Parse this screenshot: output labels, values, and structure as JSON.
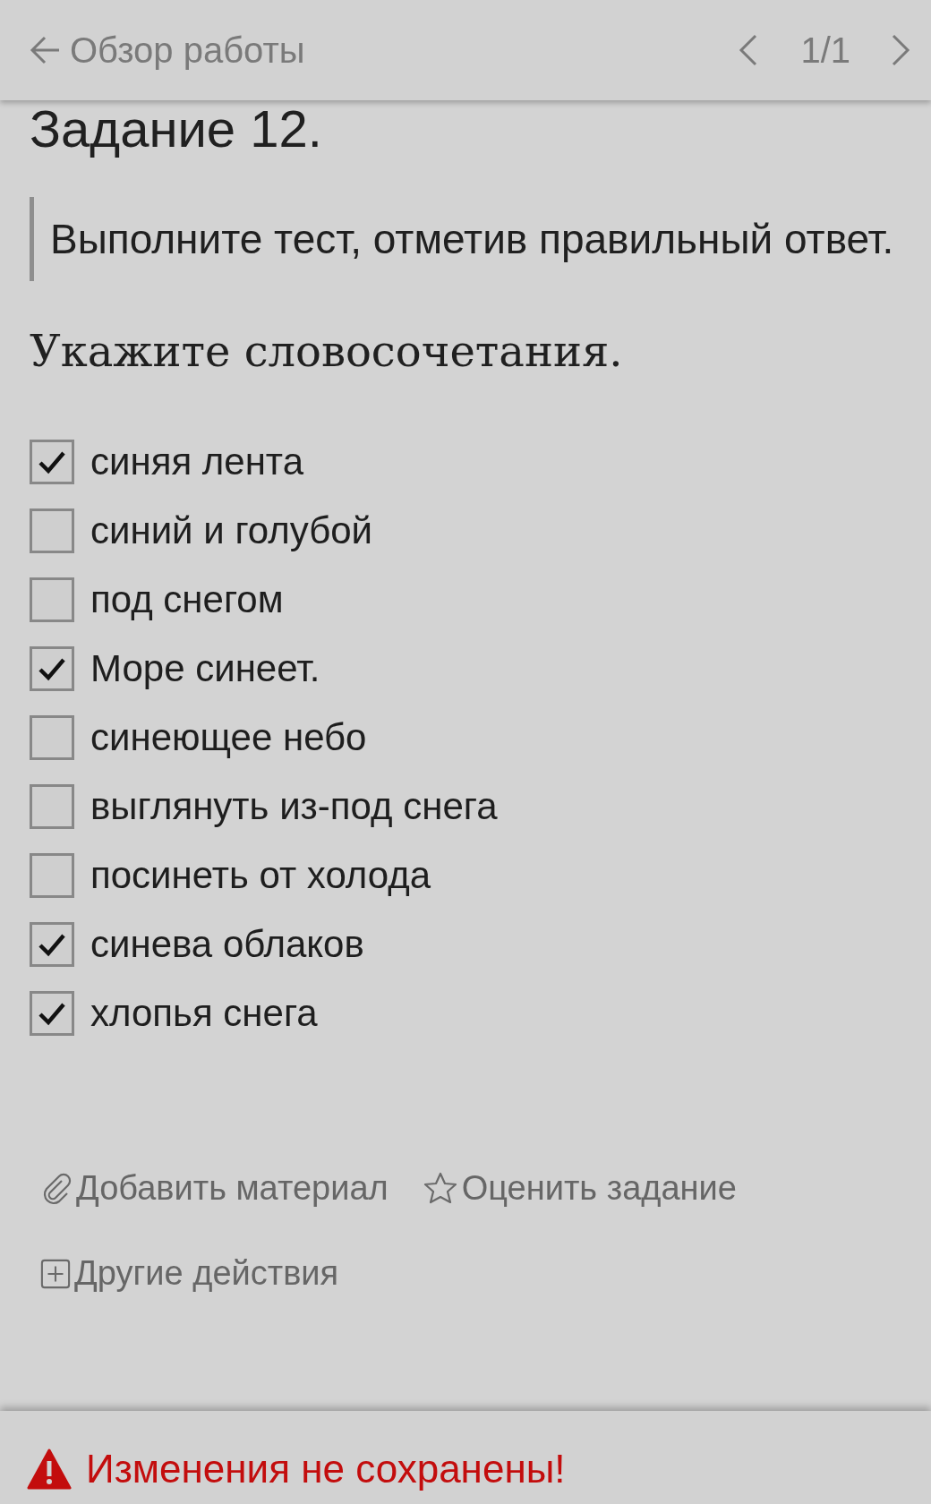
{
  "header": {
    "title": "Обзор работы",
    "counter": "1/1"
  },
  "task_title": "Задание 12.",
  "instruction": "Выполните тест, отметив правильный ответ.",
  "question": "Укажите словосочетания.",
  "options": [
    {
      "label": "синяя лента",
      "checked": true
    },
    {
      "label": "синий и голубой",
      "checked": false
    },
    {
      "label": "под снегом",
      "checked": false
    },
    {
      "label": "Море синеет.",
      "checked": true
    },
    {
      "label": "синеющее небо",
      "checked": false
    },
    {
      "label": "выглянуть из-под снега",
      "checked": false
    },
    {
      "label": "посинеть от холода",
      "checked": false
    },
    {
      "label": "синева облаков",
      "checked": true
    },
    {
      "label": "хлопья снега",
      "checked": true
    }
  ],
  "actions": [
    {
      "kind": "attach",
      "label": "Добавить материал"
    },
    {
      "kind": "rate",
      "label": "Оценить задание"
    },
    {
      "kind": "more",
      "label": "Другие действия"
    }
  ],
  "warning": "Изменения не сохранены!"
}
